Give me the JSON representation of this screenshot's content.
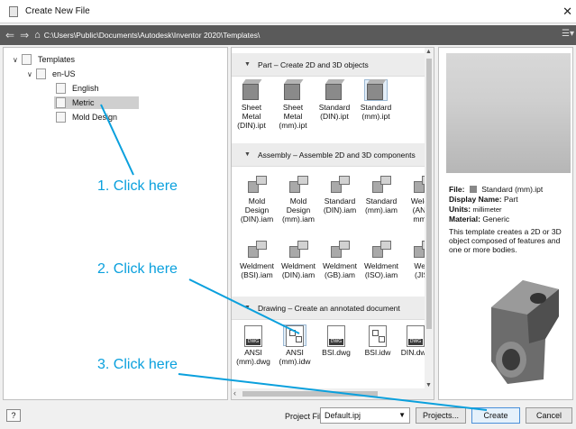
{
  "window": {
    "title": "Create New File",
    "close_glyph": "✕"
  },
  "address_bar": {
    "path": "C:\\Users\\Public\\Documents\\Autodesk\\Inventor 2020\\Templates\\"
  },
  "tree": {
    "root": "Templates",
    "locale": "en-US",
    "children": [
      "English",
      "Metric",
      "Mold Design"
    ],
    "selected": "Metric"
  },
  "sections": [
    {
      "header": "Part – Create 2D and 3D objects",
      "items": [
        {
          "lines": [
            "Sheet",
            "Metal",
            "(DIN).ipt"
          ],
          "icon": "part-cube-icon"
        },
        {
          "lines": [
            "Sheet",
            "Metal",
            "(mm).ipt"
          ],
          "icon": "part-cube-icon"
        },
        {
          "lines": [
            "Standard",
            "(DIN).ipt"
          ],
          "icon": "part-cube-icon"
        },
        {
          "lines": [
            "Standard",
            "(mm).ipt"
          ],
          "icon": "part-cube-icon",
          "selected": true
        }
      ]
    },
    {
      "header": "Assembly – Assemble 2D and 3D components",
      "items": [
        {
          "lines": [
            "Mold",
            "Design",
            "(DIN).iam"
          ],
          "icon": "assembly-icon"
        },
        {
          "lines": [
            "Mold",
            "Design",
            "(mm).iam"
          ],
          "icon": "assembly-icon"
        },
        {
          "lines": [
            "Standard",
            "(DIN).iam"
          ],
          "icon": "assembly-icon"
        },
        {
          "lines": [
            "Standard",
            "(mm).iam"
          ],
          "icon": "assembly-icon"
        },
        {
          "lines": [
            "Weldm",
            "(ANSI",
            "mm).i"
          ],
          "icon": "assembly-icon"
        },
        {
          "lines": [
            "Weldment",
            "(BSI).iam"
          ],
          "icon": "assembly-icon"
        },
        {
          "lines": [
            "Weldment",
            "(DIN).iam"
          ],
          "icon": "assembly-icon"
        },
        {
          "lines": [
            "Weldment",
            "(GB).iam"
          ],
          "icon": "assembly-icon"
        },
        {
          "lines": [
            "Weldment",
            "(ISO).iam"
          ],
          "icon": "assembly-icon"
        },
        {
          "lines": [
            "Weld",
            "(JIS)"
          ],
          "icon": "assembly-icon"
        }
      ]
    },
    {
      "header": "Drawing – Create an annotated document",
      "items": [
        {
          "lines": [
            "ANSI",
            "(mm).dwg"
          ],
          "icon": "dwg-icon"
        },
        {
          "lines": [
            "ANSI",
            "(mm).idw"
          ],
          "icon": "idw-icon",
          "selected": true
        },
        {
          "lines": [
            "BSI.dwg"
          ],
          "icon": "dwg-icon"
        },
        {
          "lines": [
            "BSI.idw"
          ],
          "icon": "idw-icon"
        },
        {
          "lines": [
            "DIN.dwg"
          ],
          "icon": "dwg-icon"
        },
        {
          "lines": [
            "D"
          ],
          "icon": "idw-icon"
        }
      ],
      "dwg_tag": "DWG"
    }
  ],
  "details": {
    "file_label": "File:",
    "file_value": "Standard (mm).ipt",
    "display_label": "Display Name:",
    "display_value": "Part",
    "units_label": "Units:",
    "units_value": "millimeter",
    "material_label": "Material:",
    "material_value": "Generic",
    "description": "This template creates a 2D or 3D object composed of features and one or more bodies."
  },
  "footer": {
    "help": "?",
    "project_file_label": "Project File:",
    "project_file_value": "Default.ipj",
    "projects_button": "Projects...",
    "create_button": "Create",
    "cancel_button": "Cancel"
  },
  "callouts": [
    "1. Click here",
    "2. Click here",
    "3. Click here"
  ],
  "colors": {
    "callout": "#0aa0dd",
    "window_bg": "#f0f0f0",
    "address_bar": "#5a5a5a"
  }
}
